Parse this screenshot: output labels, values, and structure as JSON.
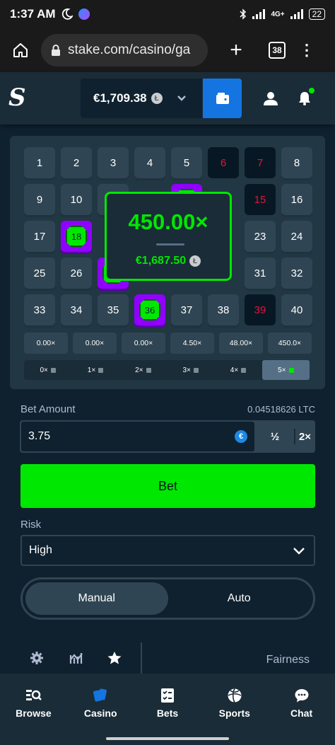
{
  "status_bar": {
    "time": "1:37 AM",
    "network": "4G+",
    "battery": "22"
  },
  "browser": {
    "url": "stake.com/casino/ga",
    "tab_count": "38"
  },
  "header": {
    "logo": "S",
    "balance": "€1,709.38",
    "currency_icon": "litecoin-icon"
  },
  "board": {
    "tiles": [
      {
        "label": "1",
        "state": "normal"
      },
      {
        "label": "2",
        "state": "normal"
      },
      {
        "label": "3",
        "state": "normal"
      },
      {
        "label": "4",
        "state": "normal"
      },
      {
        "label": "5",
        "state": "normal"
      },
      {
        "label": "6",
        "state": "dark"
      },
      {
        "label": "7",
        "state": "dark"
      },
      {
        "label": "8",
        "state": "normal"
      },
      {
        "label": "9",
        "state": "normal"
      },
      {
        "label": "10",
        "state": "normal"
      },
      {
        "label": "15",
        "state": "dark"
      },
      {
        "label": "16",
        "state": "normal"
      },
      {
        "label": "17",
        "state": "normal"
      },
      {
        "label": "18",
        "state": "gem"
      },
      {
        "label": "23",
        "state": "normal"
      },
      {
        "label": "24",
        "state": "normal"
      },
      {
        "label": "25",
        "state": "normal"
      },
      {
        "label": "26",
        "state": "normal"
      },
      {
        "label": "31",
        "state": "normal"
      },
      {
        "label": "32",
        "state": "normal"
      },
      {
        "label": "33",
        "state": "normal"
      },
      {
        "label": "34",
        "state": "normal"
      },
      {
        "label": "35",
        "state": "normal"
      },
      {
        "label": "36",
        "state": "gem"
      },
      {
        "label": "37",
        "state": "normal"
      },
      {
        "label": "38",
        "state": "normal"
      },
      {
        "label": "39",
        "state": "dark"
      },
      {
        "label": "40",
        "state": "normal"
      }
    ],
    "multipliers": [
      "0.00×",
      "0.00×",
      "0.00×",
      "4.50×",
      "48.00×",
      "450.0×"
    ],
    "hits": [
      "0×",
      "1×",
      "2×",
      "3×",
      "4×",
      "5×"
    ],
    "active_hit": "5×"
  },
  "win_popup": {
    "multiplier": "450.00×",
    "payout": "€1,687.50"
  },
  "bet": {
    "label": "Bet Amount",
    "crypto_value": "0.04518626 LTC",
    "amount": "3.75",
    "half_label": "½",
    "double_label": "2×",
    "bet_button": "Bet"
  },
  "risk": {
    "label": "Risk",
    "value": "High"
  },
  "mode": {
    "manual": "Manual",
    "auto": "Auto",
    "active": "Manual"
  },
  "toolbar": {
    "fairness": "Fairness"
  },
  "nav": {
    "items": [
      {
        "label": "Browse",
        "icon": "browse-search-icon"
      },
      {
        "label": "Casino",
        "icon": "casino-cards-icon"
      },
      {
        "label": "Bets",
        "icon": "bets-clipboard-icon"
      },
      {
        "label": "Sports",
        "icon": "sports-ball-icon"
      },
      {
        "label": "Chat",
        "icon": "chat-bubble-icon"
      }
    ]
  },
  "colors": {
    "accent_green": "#00e701",
    "brand_blue": "#1475e1",
    "selected_purple": "#9000ff",
    "background": "#0f212e",
    "panel": "#213743"
  }
}
